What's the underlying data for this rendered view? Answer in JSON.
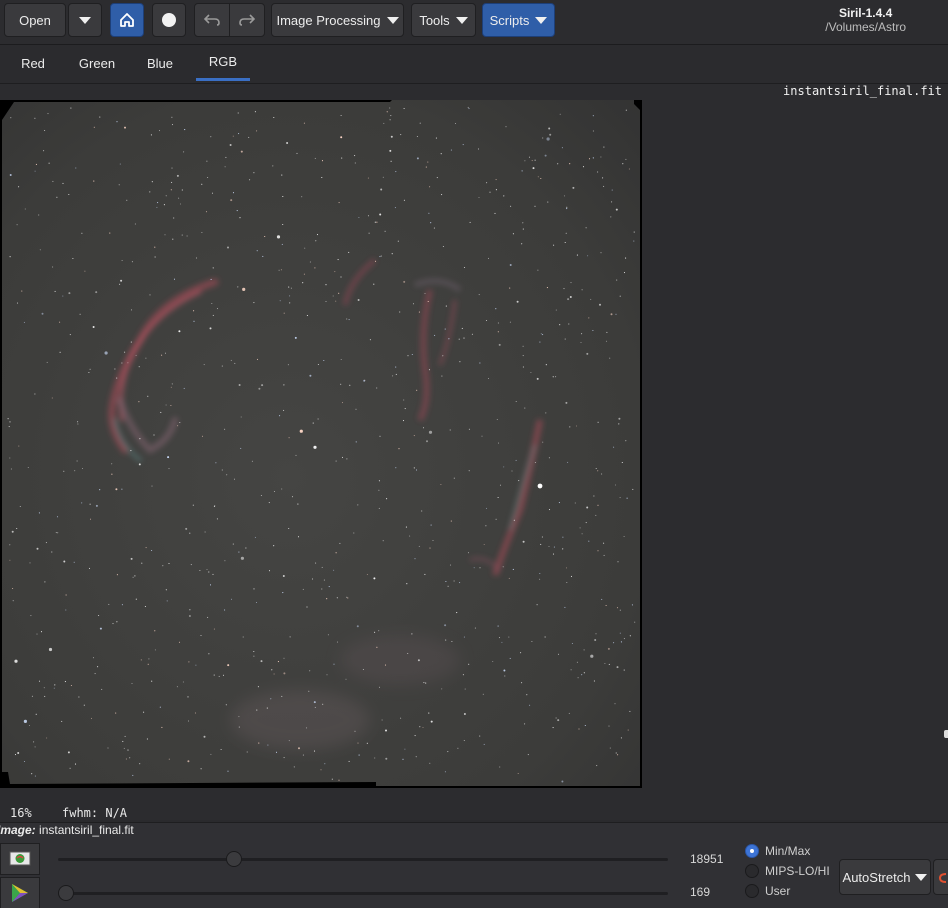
{
  "header": {
    "open_label": "Open",
    "scripts_label": "Scripts",
    "image_processing_label": "Image Processing",
    "tools_label": "Tools",
    "app_title": "Siril-1.4.4",
    "working_dir": "/Volumes/Astro",
    "icons": [
      "dropdown-caret-icon",
      "home-icon",
      "live-stack-dot-icon",
      "undo-icon",
      "redo-icon"
    ]
  },
  "tabs": [
    {
      "label": "Red",
      "active": false
    },
    {
      "label": "Green",
      "active": false
    },
    {
      "label": "Blue",
      "active": false
    },
    {
      "label": "RGB",
      "active": true
    }
  ],
  "viewport": {
    "filename": "instantsiril_final.fit"
  },
  "status": {
    "zoom": "16%",
    "fwhm": "fwhm: N/A"
  },
  "bottom": {
    "image_prefix": "Image:",
    "image_name": "instantsiril_final.fit",
    "hi_value": "18951",
    "lo_value": "169",
    "hi_level": 0.288,
    "lo_level": 0.0,
    "modes": [
      {
        "label": "Min/Max",
        "selected": true
      },
      {
        "label": "MIPS-LO/HI",
        "selected": false
      },
      {
        "label": "User",
        "selected": false
      }
    ],
    "autostretch_label": "AutoStretch"
  },
  "colors": {
    "accent": "#2f5ea8",
    "tab_underline": "#3a6fc4",
    "nebula": "#b04a5a"
  }
}
